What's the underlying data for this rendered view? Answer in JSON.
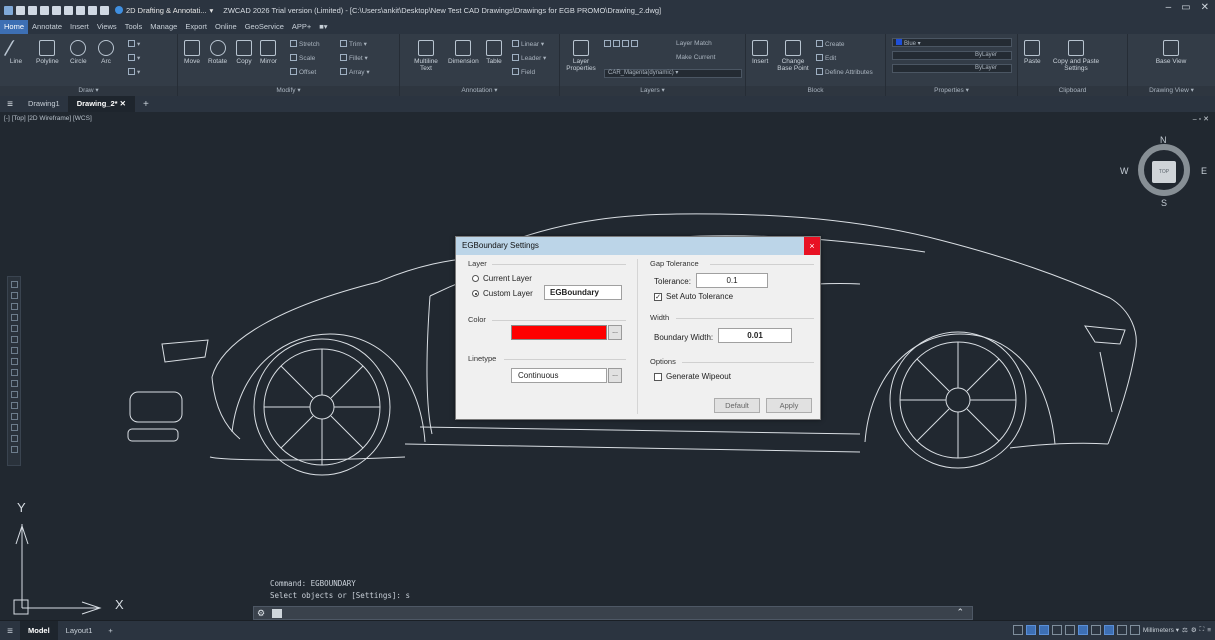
{
  "titlebar": {
    "workspace": "2D Drafting & Annotati...",
    "title": "ZWCAD 2026 Trial version (Limited) - [C:\\Users\\ankit\\Desktop\\New Test CAD Drawings\\Drawings for EGB PROMO\\Drawing_2.dwg]"
  },
  "menu": {
    "tabs": [
      "Home",
      "Annotate",
      "Insert",
      "Views",
      "Tools",
      "Manage",
      "Export",
      "Online",
      "GeoService",
      "APP+"
    ]
  },
  "ribbon": {
    "draw": {
      "title": "Draw",
      "line": "Line",
      "polyline": "Polyline",
      "circle": "Circle",
      "arc": "Arc"
    },
    "modify": {
      "title": "Modify",
      "move": "Move",
      "rotate": "Rotate",
      "copy": "Copy",
      "mirror": "Mirror",
      "stretch": "Stretch",
      "trim": "Trim",
      "scale": "Scale",
      "fillet": "Fillet",
      "offset": "Offset",
      "array": "Array"
    },
    "annotation": {
      "title": "Annotation",
      "mtext": "Multiline Text",
      "dimension": "Dimension",
      "table": "Table",
      "linear": "Linear",
      "leader": "Leader",
      "field": "Field"
    },
    "layers": {
      "title": "Layers",
      "layer_props": "Layer Properties",
      "layer_match": "Layer Match",
      "make_current": "Make Current",
      "layer_dropdown": "CAR_Magenta(dynamic)"
    },
    "block": {
      "title": "Block",
      "insert": "Insert",
      "change_base": "Change Base Point",
      "create": "Create",
      "edit": "Edit",
      "define_attr": "Define Attributes"
    },
    "properties": {
      "title": "Properties",
      "color": "Blue",
      "linetype": "ByLayer",
      "lineweight": "ByLayer"
    },
    "clipboard": {
      "title": "Clipboard",
      "paste": "Paste",
      "copy_paste_settings": "Copy and Paste Settings"
    },
    "drawing_view": {
      "title": "Drawing View",
      "base_view": "Base View"
    }
  },
  "doc_tabs": [
    "Drawing1",
    "Drawing_2*"
  ],
  "viewport": {
    "label": "[-] [Top] [2D Wireframe] [WCS]",
    "viewcube": {
      "n": "N",
      "s": "S",
      "e": "E",
      "w": "W",
      "top": "TOP"
    },
    "ucs": {
      "x": "X",
      "y": "Y"
    }
  },
  "command": {
    "history": [
      "Command: EGBOUNDARY",
      "Select objects or [Settings]: s"
    ]
  },
  "layout_tabs": [
    "Model",
    "Layout1"
  ],
  "status": {
    "units": "Millimeters"
  },
  "dialog": {
    "title": "EGBoundary Settings",
    "close": "×",
    "layer_group": "Layer",
    "current_layer": "Current Layer",
    "custom_layer": "Custom Layer",
    "custom_layer_value": "EGBoundary",
    "color_group": "Color",
    "color_value": "#ff0000",
    "ellipsis": "...",
    "linetype_group": "Linetype",
    "linetype_value": "Continuous",
    "gap_group": "Gap Tolerance",
    "tolerance_label": "Tolerance:",
    "tolerance_value": "0.1",
    "auto_tolerance": "Set Auto Tolerance",
    "auto_tolerance_checked": true,
    "width_group": "Width",
    "boundary_width_label": "Boundary Width:",
    "boundary_width_value": "0.01",
    "options_group": "Options",
    "generate_wipeout": "Generate Wipeout",
    "generate_wipeout_checked": false,
    "default_button": "Default",
    "apply_button": "Apply"
  }
}
